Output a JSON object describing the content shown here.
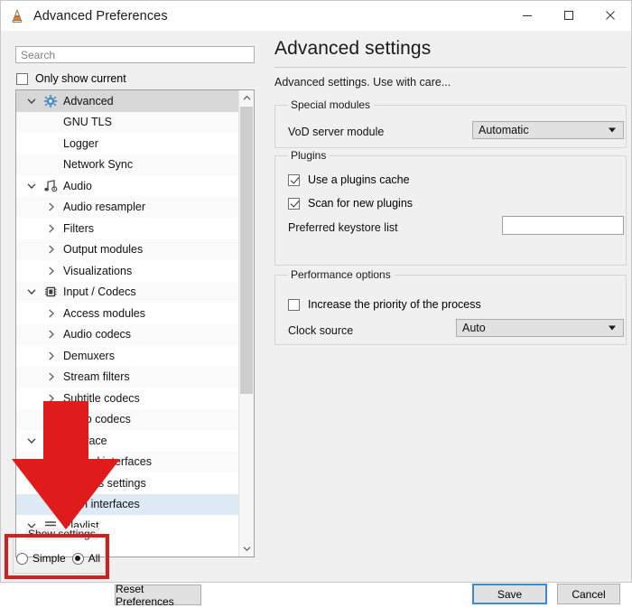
{
  "window": {
    "title": "Advanced Preferences",
    "app_icon": "vlc-cone-icon",
    "controls": {
      "minimize": "minimize-icon",
      "maximize": "maximize-icon",
      "close": "close-icon"
    }
  },
  "left": {
    "search": {
      "value": "",
      "placeholder": "Search"
    },
    "only_show_current": {
      "label": "Only show current",
      "checked": false
    },
    "tree": [
      {
        "label": "Advanced",
        "level": 0,
        "icon": "gear-icon",
        "expander": "chevron-down",
        "state": "selected"
      },
      {
        "label": "GNU TLS",
        "level": 1,
        "icon": "",
        "expander": "",
        "state": "normal"
      },
      {
        "label": "Logger",
        "level": 1,
        "icon": "",
        "expander": "",
        "state": "normal"
      },
      {
        "label": "Network Sync",
        "level": 1,
        "icon": "",
        "expander": "",
        "state": "normal"
      },
      {
        "label": "Audio",
        "level": 0,
        "icon": "music-note-icon",
        "expander": "chevron-down",
        "state": "normal"
      },
      {
        "label": "Audio resampler",
        "level": 1,
        "icon": "",
        "expander": "chevron-right",
        "state": "normal"
      },
      {
        "label": "Filters",
        "level": 1,
        "icon": "",
        "expander": "chevron-right",
        "state": "normal"
      },
      {
        "label": "Output modules",
        "level": 1,
        "icon": "",
        "expander": "chevron-right",
        "state": "normal"
      },
      {
        "label": "Visualizations",
        "level": 1,
        "icon": "",
        "expander": "chevron-right",
        "state": "normal"
      },
      {
        "label": "Input / Codecs",
        "level": 0,
        "icon": "codec-chip-icon",
        "expander": "chevron-down",
        "state": "normal"
      },
      {
        "label": "Access modules",
        "level": 1,
        "icon": "",
        "expander": "chevron-right",
        "state": "normal"
      },
      {
        "label": "Audio codecs",
        "level": 1,
        "icon": "",
        "expander": "chevron-right",
        "state": "normal"
      },
      {
        "label": "Demuxers",
        "level": 1,
        "icon": "",
        "expander": "chevron-right",
        "state": "normal"
      },
      {
        "label": "Stream filters",
        "level": 1,
        "icon": "",
        "expander": "chevron-right",
        "state": "normal"
      },
      {
        "label": "Subtitle codecs",
        "level": 1,
        "icon": "",
        "expander": "chevron-right",
        "state": "normal"
      },
      {
        "label": "Video codecs",
        "level": 1,
        "icon": "",
        "expander": "chevron-right",
        "state": "normal"
      },
      {
        "label": "Interface",
        "level": 0,
        "icon": "interface-icon",
        "expander": "chevron-down",
        "state": "normal"
      },
      {
        "label": "Control interfaces",
        "level": 1,
        "icon": "",
        "expander": "chevron-right",
        "state": "normal"
      },
      {
        "label": "Hotkeys settings",
        "level": 1,
        "icon": "",
        "expander": "",
        "state": "normal"
      },
      {
        "label": "Main interfaces",
        "level": 1,
        "icon": "",
        "expander": "chevron-right",
        "state": "highlighted"
      },
      {
        "label": "Playlist",
        "level": 0,
        "icon": "playlist-icon",
        "expander": "chevron-down",
        "state": "normal"
      }
    ],
    "show_settings": {
      "title": "Show settings",
      "options": [
        {
          "label": "Simple",
          "selected": false
        },
        {
          "label": "All",
          "selected": true
        }
      ]
    },
    "reset_button": "Reset Preferences"
  },
  "right": {
    "heading": "Advanced settings",
    "description": "Advanced settings. Use with care...",
    "groups": [
      {
        "title": "Special modules",
        "fields": [
          {
            "label": "VoD server module",
            "type": "combo",
            "value": "Automatic"
          }
        ]
      },
      {
        "title": "Plugins",
        "fields": [
          {
            "label": "Use a plugins cache",
            "type": "checkbox",
            "checked": true
          },
          {
            "label": "Scan for new plugins",
            "type": "checkbox",
            "checked": true
          },
          {
            "label": "Preferred keystore list",
            "type": "text",
            "value": ""
          }
        ]
      },
      {
        "title": "Performance options",
        "fields": [
          {
            "label": "Increase the priority of the process",
            "type": "checkbox",
            "checked": false
          },
          {
            "label": "Clock source",
            "type": "combo",
            "value": "Auto"
          }
        ]
      }
    ]
  },
  "footer": {
    "save": "Save",
    "cancel": "Cancel"
  },
  "annotations": {
    "arrow_color": "#e01b1b",
    "highlight_color": "#d02020",
    "arrow_target": "show-settings-group",
    "highlight_target": "show-settings-group"
  }
}
